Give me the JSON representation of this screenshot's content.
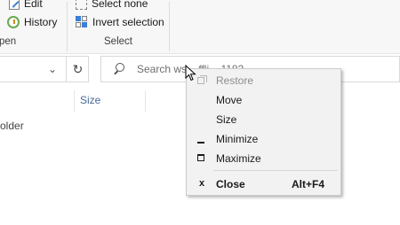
{
  "ribbon": {
    "open_group": {
      "edit_label": "Edit",
      "history_label": "History",
      "group_label": "pen"
    },
    "select_group": {
      "select_none_label": "Select none",
      "invert_selection_label": "Invert selection",
      "group_label": "Select"
    }
  },
  "search": {
    "text": "Search ws... ffli... 1182"
  },
  "file_list": {
    "column_size": "Size",
    "row_partial_text": "older"
  },
  "context_menu": {
    "items": [
      {
        "label": "Restore",
        "enabled": false,
        "glyph": "restore-icon"
      },
      {
        "label": "Move",
        "enabled": true
      },
      {
        "label": "Size",
        "enabled": true
      },
      {
        "label": "Minimize",
        "enabled": true,
        "glyph": "minimize-icon"
      },
      {
        "label": "Maximize",
        "enabled": true,
        "glyph": "maximize-icon"
      },
      {
        "label": "Close",
        "enabled": true,
        "glyph": "x",
        "accelerator": "Alt+F4"
      }
    ]
  },
  "colors": {
    "menu_bg": "#f2f2f2",
    "ribbon_bg": "#f7f7f7",
    "disabled_text": "#8c8c8c",
    "accent": "#3c7fd6"
  }
}
